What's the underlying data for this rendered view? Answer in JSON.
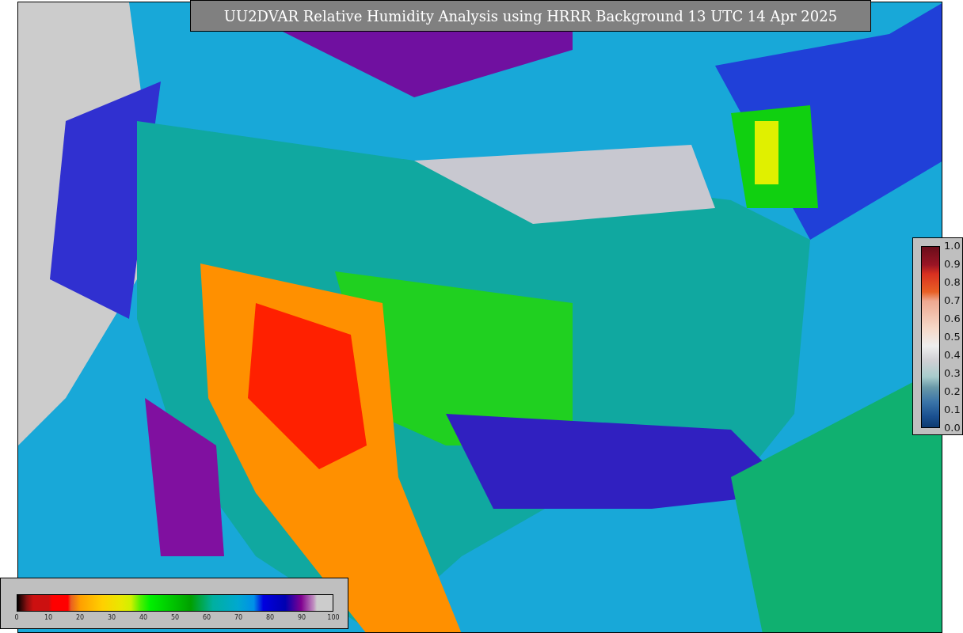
{
  "title": "UU2DVAR Relative Humidity Analysis using HRRR Background 13 UTC 14 Apr 2025",
  "humidity_colorbar": {
    "ticks": [
      "0",
      "10",
      "20",
      "30",
      "40",
      "50",
      "60",
      "70",
      "80",
      "90",
      "100"
    ]
  },
  "ratio_colorbar": {
    "ticks": [
      "1.0",
      "0.9",
      "0.8",
      "0.7",
      "0.6",
      "0.5",
      "0.4",
      "0.3",
      "0.2",
      "0.1",
      "0.0"
    ]
  }
}
